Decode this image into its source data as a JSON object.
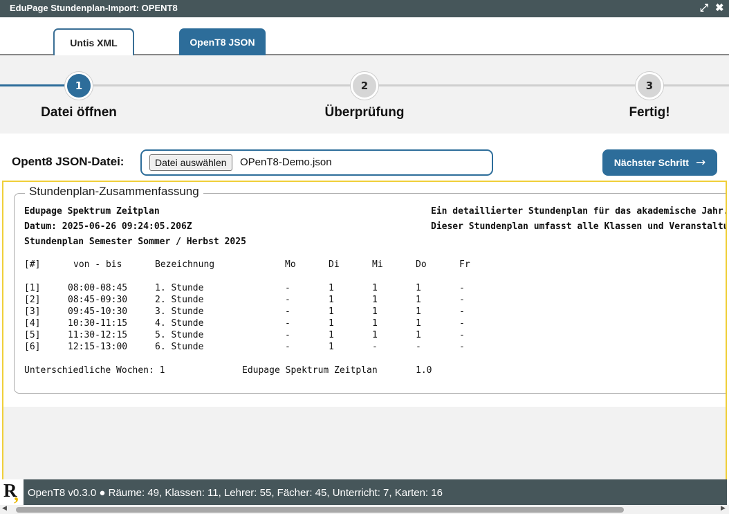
{
  "window": {
    "title": "EduPage Stundenplan-Import: OPENT8",
    "expand_icon": "expand-icon",
    "close_icon": "close-icon"
  },
  "tabs": [
    {
      "label": "Untis XML",
      "active": false
    },
    {
      "label": "OpenT8 JSON",
      "active": true
    }
  ],
  "steps": [
    {
      "number": "1",
      "label": "Datei öffnen",
      "state": "done"
    },
    {
      "number": "2",
      "label": "Überprüfung",
      "state": "todo"
    },
    {
      "number": "3",
      "label": "Fertig!",
      "state": "todo"
    }
  ],
  "file": {
    "label": "Opent8 JSON-Datei:",
    "button": "Datei auswählen",
    "filename": "OPenT8-Demo.json"
  },
  "next": {
    "label": "Nächster Schritt",
    "arrow": "→"
  },
  "summary": {
    "legend": "Stundenplan-Zusammenfassung",
    "name": "Edupage Spektrum Zeitplan",
    "date": "Datum: 2025-06-26 09:24:05.206Z",
    "semester": "Stundenplan Semester Sommer / Herbst 2025",
    "desc1": "Ein detaillierter Stundenplan für das akademische Jahr.",
    "desc2": "Dieser Stundenplan umfasst alle Klassen und Veranstaltungen.",
    "headers": [
      "[#]",
      "von - bis",
      "Bezeichnung",
      "Mo",
      "Di",
      "Mi",
      "Do",
      "Fr"
    ],
    "rows": [
      [
        "[1]",
        "08:00-08:45",
        "1. Stunde",
        "-",
        "1",
        "1",
        "1",
        "-"
      ],
      [
        "[2]",
        "08:45-09:30",
        "2. Stunde",
        "-",
        "1",
        "1",
        "1",
        "-"
      ],
      [
        "[3]",
        "09:45-10:30",
        "3. Stunde",
        "-",
        "1",
        "1",
        "1",
        "-"
      ],
      [
        "[4]",
        "10:30-11:15",
        "4. Stunde",
        "-",
        "1",
        "1",
        "1",
        "-"
      ],
      [
        "[5]",
        "11:30-12:15",
        "5. Stunde",
        "-",
        "1",
        "1",
        "1",
        "-"
      ],
      [
        "[6]",
        "12:15-13:00",
        "6. Stunde",
        "-",
        "1",
        "-",
        "-",
        "-"
      ]
    ],
    "footer_weeks": "Unterschiedliche Wochen: 1",
    "footer_name": "Edupage Spektrum Zeitplan",
    "footer_version": "1.0"
  },
  "status": {
    "text": "OpenT8 v0.3.0 ● Räume: 49, Klassen: 11, Lehrer: 55, Fächer: 45, Unterricht: 7, Karten: 16"
  },
  "colors": {
    "accent": "#2d6d9a",
    "titlebar": "#46565a",
    "highlight": "#f0cf3a"
  }
}
